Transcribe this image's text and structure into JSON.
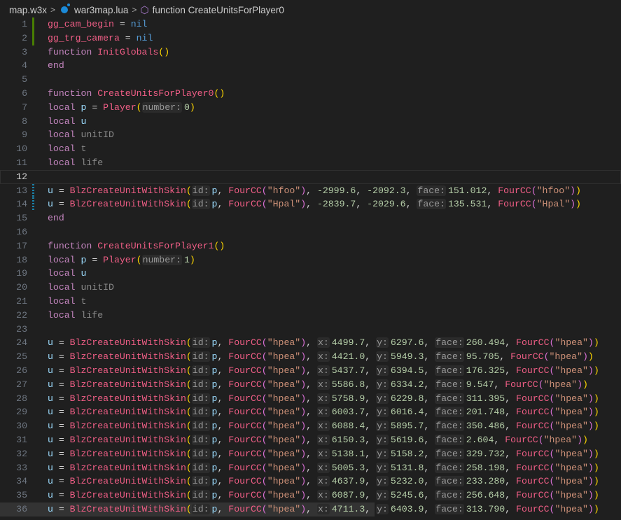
{
  "breadcrumb": {
    "folder": "map.w3x",
    "file": "war3map.lua",
    "symbol": "function CreateUnitsForPlayer0"
  },
  "current_line": 12,
  "markers": {
    "add": [
      1,
      2
    ],
    "mod": [
      13,
      14
    ]
  },
  "lines": [
    [
      "v:gg_cam_begin",
      "o: = ",
      "n:nil"
    ],
    [
      "v:gg_trg_camera",
      "o: = ",
      "n:nil"
    ],
    [
      "k:function ",
      "f:InitGlobals",
      "p:()"
    ],
    [
      "k:end"
    ],
    [],
    [
      "k:function ",
      "f:CreateUnitsForPlayer0",
      "p:()"
    ],
    [
      "k:local ",
      "l:p",
      "o: = ",
      "f:Player",
      "p:(",
      "h:number:",
      "d:0",
      "p:)"
    ],
    [
      "k:local ",
      "l:u"
    ],
    [
      "k:local ",
      "u:unitID"
    ],
    [
      "k:local ",
      "u:t"
    ],
    [
      "k:local ",
      "u:life"
    ],
    [],
    [
      "l:u",
      "o: = ",
      "f:BlzCreateUnitWithSkin",
      "p:(",
      "h:id:",
      "l:p",
      "o:, ",
      "f:FourCC",
      "q:(",
      "s:\"hfoo\"",
      "q:)",
      "o:, ",
      "d:-2999.6",
      "o:, ",
      "d:-2092.3",
      "o:, ",
      "h:face:",
      "d:151.012",
      "o:, ",
      "f:FourCC",
      "q:(",
      "s:\"hfoo\"",
      "q:)",
      "p:)"
    ],
    [
      "l:u",
      "o: = ",
      "f:BlzCreateUnitWithSkin",
      "p:(",
      "h:id:",
      "l:p",
      "o:, ",
      "f:FourCC",
      "q:(",
      "s:\"Hpal\"",
      "q:)",
      "o:, ",
      "d:-2839.7",
      "o:, ",
      "d:-2029.6",
      "o:, ",
      "h:face:",
      "d:135.531",
      "o:, ",
      "f:FourCC",
      "q:(",
      "s:\"Hpal\"",
      "q:)",
      "p:)"
    ],
    [
      "k:end"
    ],
    [],
    [
      "k:function ",
      "f:CreateUnitsForPlayer1",
      "p:()"
    ],
    [
      "k:local ",
      "l:p",
      "o: = ",
      "f:Player",
      "p:(",
      "h:number:",
      "d:1",
      "p:)"
    ],
    [
      "k:local ",
      "l:u"
    ],
    [
      "k:local ",
      "u:unitID"
    ],
    [
      "k:local ",
      "u:t"
    ],
    [
      "k:local ",
      "u:life"
    ],
    []
  ],
  "hpea_units": [
    [
      "4499.7",
      "6297.6",
      "260.494"
    ],
    [
      "4421.0",
      "5949.3",
      "95.705"
    ],
    [
      "5437.7",
      "6394.5",
      "176.325"
    ],
    [
      "5586.8",
      "6334.2",
      "9.547"
    ],
    [
      "5758.9",
      "6229.8",
      "311.395"
    ],
    [
      "6003.7",
      "6016.4",
      "201.748"
    ],
    [
      "6088.4",
      "5895.7",
      "350.486"
    ],
    [
      "6150.3",
      "5619.6",
      "2.604"
    ],
    [
      "5138.1",
      "5158.2",
      "329.732"
    ],
    [
      "5005.3",
      "5131.8",
      "258.198"
    ],
    [
      "4637.9",
      "5232.0",
      "233.280"
    ],
    [
      "6087.9",
      "5245.6",
      "256.648"
    ],
    [
      "4711.3",
      "6403.9",
      "313.790"
    ]
  ]
}
